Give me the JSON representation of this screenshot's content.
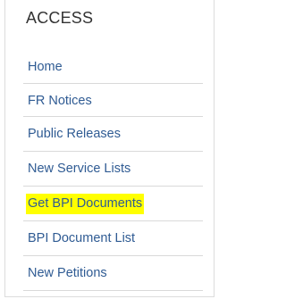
{
  "sidebar": {
    "title": "ACCESS",
    "items": [
      {
        "label": "Home"
      },
      {
        "label": "FR Notices"
      },
      {
        "label": "Public Releases"
      },
      {
        "label": "New Service Lists"
      },
      {
        "label": "Get BPI Documents",
        "highlighted": true
      },
      {
        "label": "BPI Document List"
      },
      {
        "label": "New Petitions"
      }
    ]
  },
  "colors": {
    "link": "#2f5b93",
    "title": "#333333",
    "highlight": "#ffff00",
    "divider": "#d9d9d9"
  }
}
